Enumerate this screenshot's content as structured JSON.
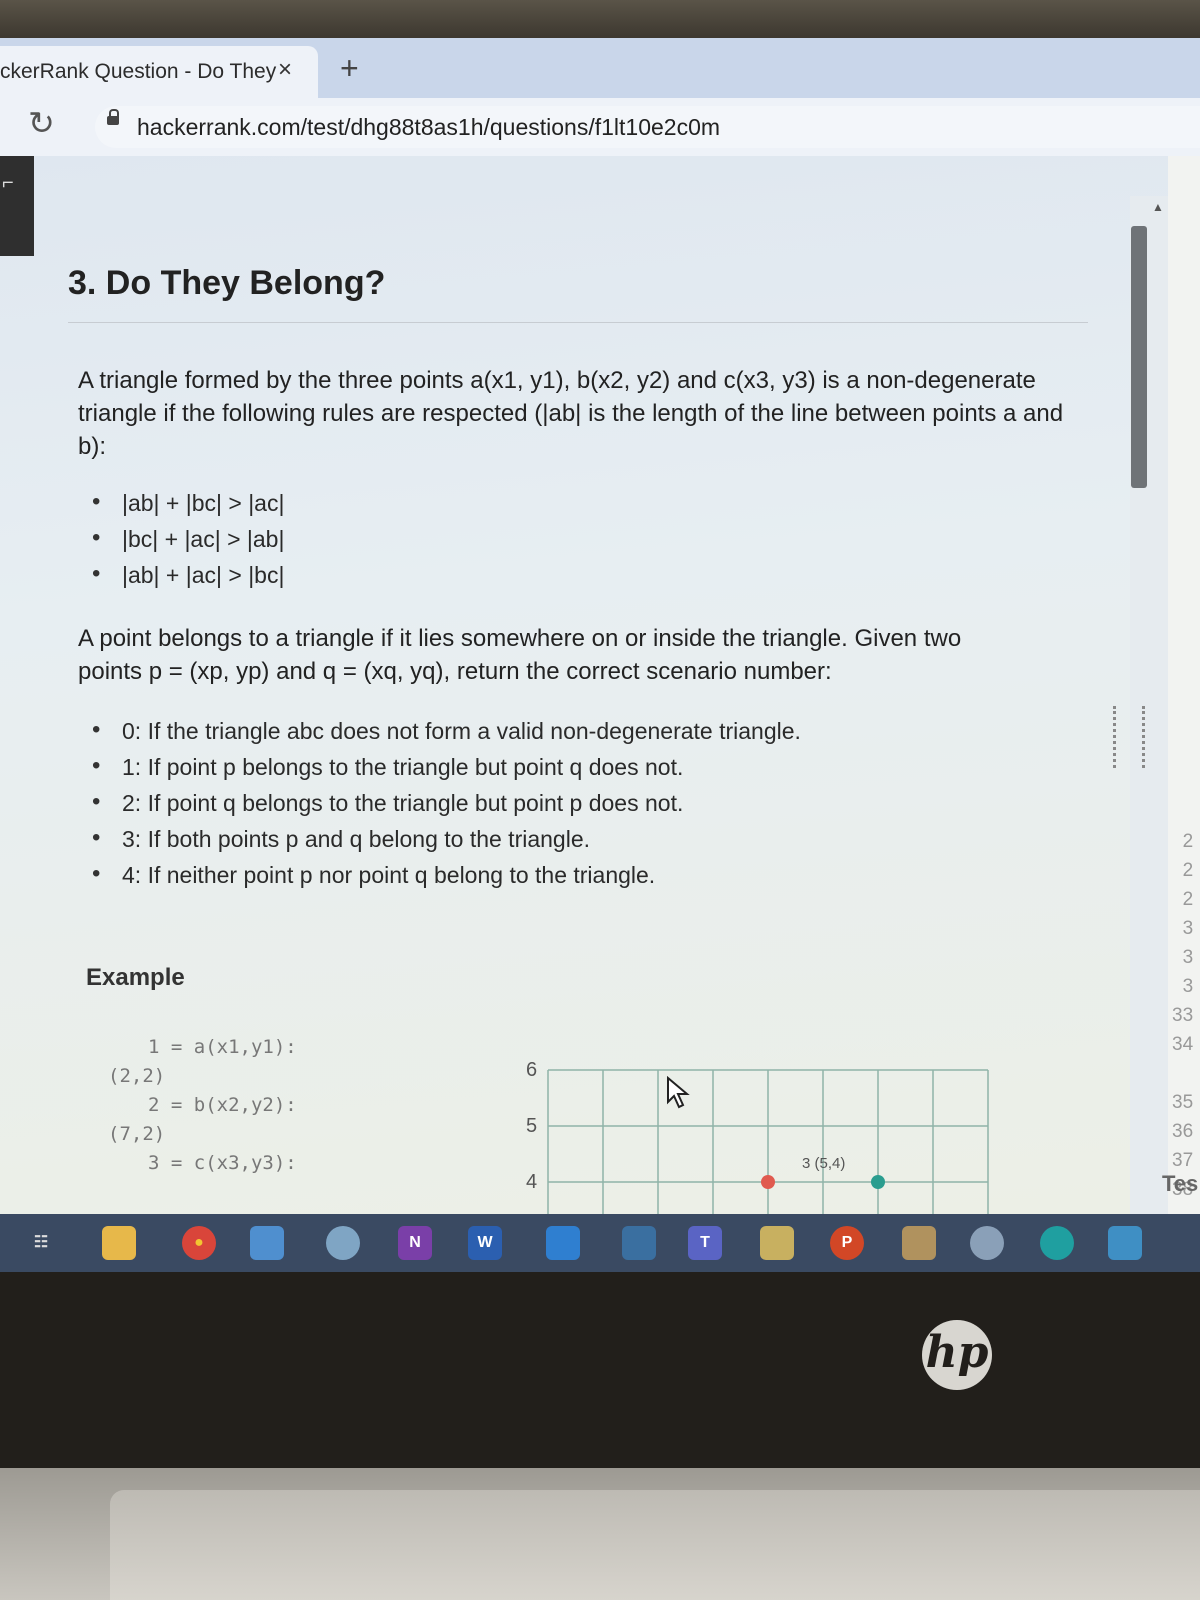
{
  "browser": {
    "tab_title": "ckerRank Question - Do They",
    "tab_close": "×",
    "new_tab": "+",
    "url": "hackerrank.com/test/dhg88t8as1h/questions/f1lt10e2c0m"
  },
  "question": {
    "heading": "3. Do They Belong?",
    "intro": "A triangle formed by the three points a(x1, y1), b(x2, y2) and c(x3, y3) is a non-degenerate triangle if the following rules are respected (|ab| is the length of the line between points a and b):",
    "rules": [
      "|ab| + |bc| > |ac|",
      "|bc| + |ac| > |ab|",
      "|ab| + |ac| > |bc|"
    ],
    "belongs": "A point belongs to a triangle if it lies somewhere on or inside the triangle. Given two points p = (xp, yp) and q = (xq, yq), return the correct scenario number:",
    "scenarios": [
      "0: If the triangle abc does not form a valid non-degenerate triangle.",
      "1: If point p belongs to the triangle but point q does not.",
      "2: If point q belongs to the triangle but point p does not.",
      "3: If both points p and q belong to the triangle.",
      "4: If neither point p nor point q belong to the triangle."
    ],
    "example_heading": "Example",
    "code_lines": [
      "1 = a(x1,y1):",
      "(2,2)",
      "2 = b(x2,y2):",
      "(7,2)",
      "3 = c(x3,y3):"
    ]
  },
  "chart_data": {
    "type": "scatter",
    "y_ticks": [
      "6",
      "5",
      "4"
    ],
    "points": [
      {
        "label": "3 (5,4)",
        "x": 5,
        "y": 4,
        "color": "#e05a4f"
      },
      {
        "x": 7,
        "y": 4,
        "color": "#2a9d8f"
      }
    ]
  },
  "editor": {
    "line_numbers": [
      "2",
      "2",
      "2",
      "3",
      "3",
      "3",
      "33",
      "34",
      "",
      "35",
      "36",
      "37",
      "38"
    ],
    "test_label": "Tes"
  },
  "taskbar": {
    "apps": [
      "task-view",
      "file-explorer",
      "chrome",
      "notes",
      "paint",
      "onenote",
      "word",
      "vscode",
      "photos",
      "teams",
      "whiteboard",
      "powerpoint",
      "snip",
      "settings",
      "edge",
      "photos-viewer"
    ]
  },
  "device": {
    "brand": "hp"
  }
}
